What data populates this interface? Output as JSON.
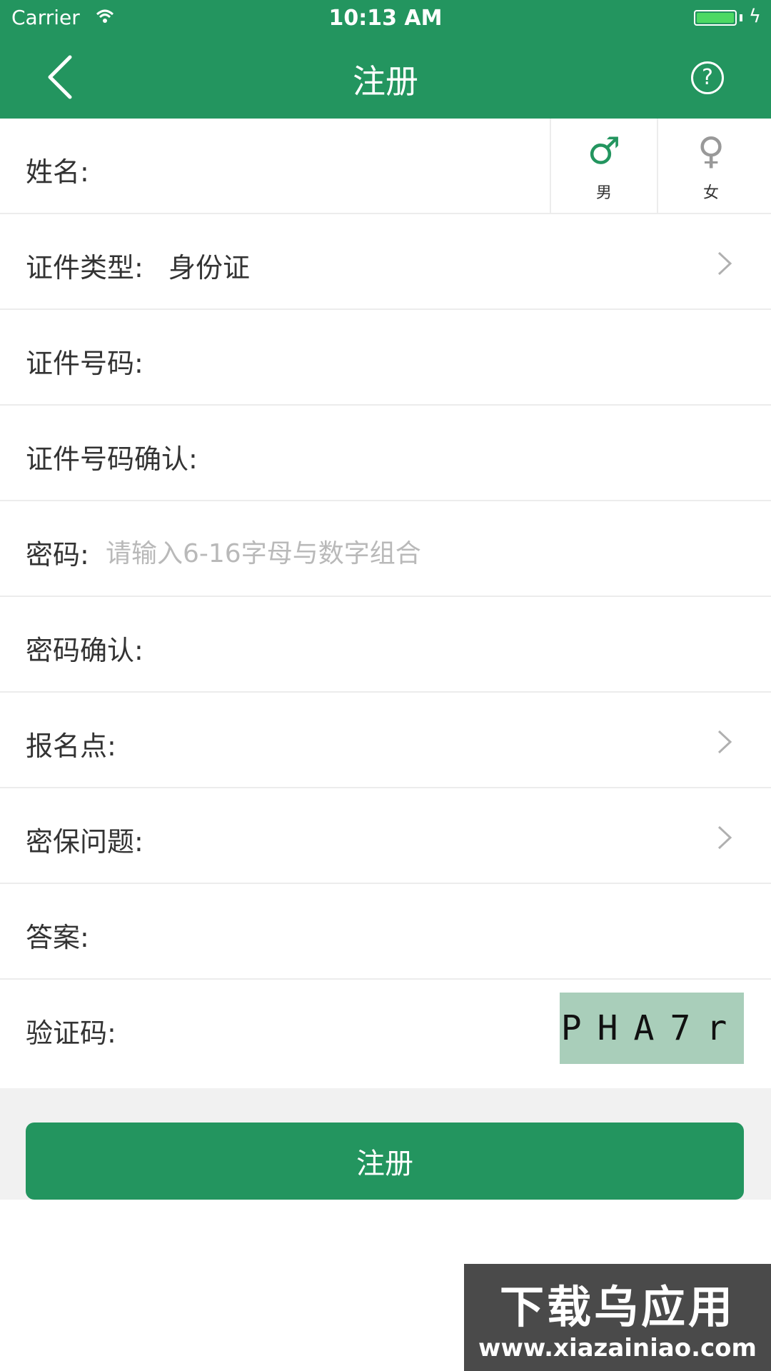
{
  "status_bar": {
    "carrier": "Carrier",
    "time": "10:13 AM"
  },
  "nav": {
    "title": "注册",
    "help_symbol": "?"
  },
  "form": {
    "name_label": "姓名:",
    "gender": {
      "male_symbol": "♂",
      "male_label": "男",
      "female_symbol": "♀",
      "female_label": "女"
    },
    "id_type_label": "证件类型:",
    "id_type_value": "身份证",
    "id_number_label": "证件号码:",
    "id_confirm_label": "证件号码确认:",
    "password_label": "密码:",
    "password_placeholder": "请输入6-16字母与数字组合",
    "password_confirm_label": "密码确认:",
    "signup_point_label": "报名点:",
    "security_question_label": "密保问题:",
    "answer_label": "答案:",
    "captcha_label": "验证码:",
    "captcha_text": "PHA7r"
  },
  "submit_label": "注册",
  "watermark": {
    "title": "下载乌应用",
    "url": "www.xiazainiao.com"
  },
  "colors": {
    "primary": "#23955f",
    "captcha_bg": "#a9ceba",
    "placeholder": "#b9b9b9"
  }
}
